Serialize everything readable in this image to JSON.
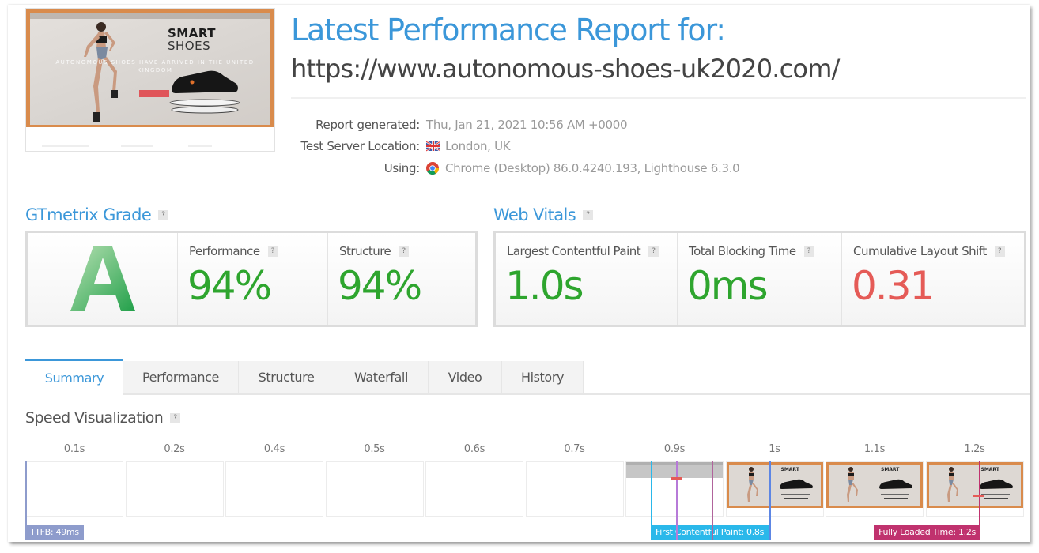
{
  "thumbnail": {
    "brand_line1": "SMART",
    "brand_line2": "SHOES",
    "tagline": "AUTONOMOUS SHOES HAVE ARRIVED IN THE UNITED KINGDOM"
  },
  "header": {
    "title": "Latest Performance Report for:",
    "url": "https://www.autonomous-shoes-uk2020.com/"
  },
  "meta": [
    {
      "label": "Report generated:",
      "value": "Thu, Jan 21, 2021 10:56 AM +0000",
      "icon": null
    },
    {
      "label": "Test Server Location:",
      "value": "London, UK",
      "icon": "uk-flag-icon"
    },
    {
      "label": "Using:",
      "value": "Chrome (Desktop) 86.0.4240.193, Lighthouse 6.3.0",
      "icon": "chrome-icon"
    }
  ],
  "grade": {
    "title": "GTmetrix Grade",
    "help": "?",
    "letter": "A",
    "metrics": [
      {
        "label": "Performance",
        "value": "94%",
        "status": "good"
      },
      {
        "label": "Structure",
        "value": "94%",
        "status": "good"
      }
    ]
  },
  "vitals": {
    "title": "Web Vitals",
    "help": "?",
    "metrics": [
      {
        "label": "Largest Contentful Paint",
        "value": "1.0s",
        "status": "good"
      },
      {
        "label": "Total Blocking Time",
        "value": "0ms",
        "status": "good"
      },
      {
        "label": "Cumulative Layout Shift",
        "value": "0.31",
        "status": "bad"
      }
    ]
  },
  "tabs": [
    {
      "label": "Summary",
      "active": true
    },
    {
      "label": "Performance",
      "active": false
    },
    {
      "label": "Structure",
      "active": false
    },
    {
      "label": "Waterfall",
      "active": false
    },
    {
      "label": "Video",
      "active": false
    },
    {
      "label": "History",
      "active": false
    }
  ],
  "speed": {
    "title": "Speed Visualization",
    "help": "?",
    "frames": [
      {
        "time": "0.1s",
        "state": "blank"
      },
      {
        "time": "0.2s",
        "state": "blank"
      },
      {
        "time": "0.4s",
        "state": "blank"
      },
      {
        "time": "0.5s",
        "state": "blank"
      },
      {
        "time": "0.6s",
        "state": "blank"
      },
      {
        "time": "0.7s",
        "state": "blank"
      },
      {
        "time": "0.9s",
        "state": "partial"
      },
      {
        "time": "1s",
        "state": "rendered"
      },
      {
        "time": "1.1s",
        "state": "rendered"
      },
      {
        "time": "1.2s",
        "state": "rendered"
      }
    ],
    "markers": {
      "ttfb": {
        "label": "TTFB: 49ms",
        "color": "#8e9ccc"
      },
      "fcp": {
        "label": "First Contentful Paint: 0.8s",
        "color": "#2ab8ea"
      },
      "fully_loaded": {
        "label": "Fully Loaded Time: 1.2s",
        "color": "#c0326e"
      },
      "lcp_color": "#5d86e4",
      "extra_line_1_color": "#b77ad8",
      "extra_line_2_color": "#b0649c"
    }
  },
  "colors": {
    "accent": "#3b97d9",
    "good": "#2ea52e",
    "bad": "#e55b57"
  }
}
